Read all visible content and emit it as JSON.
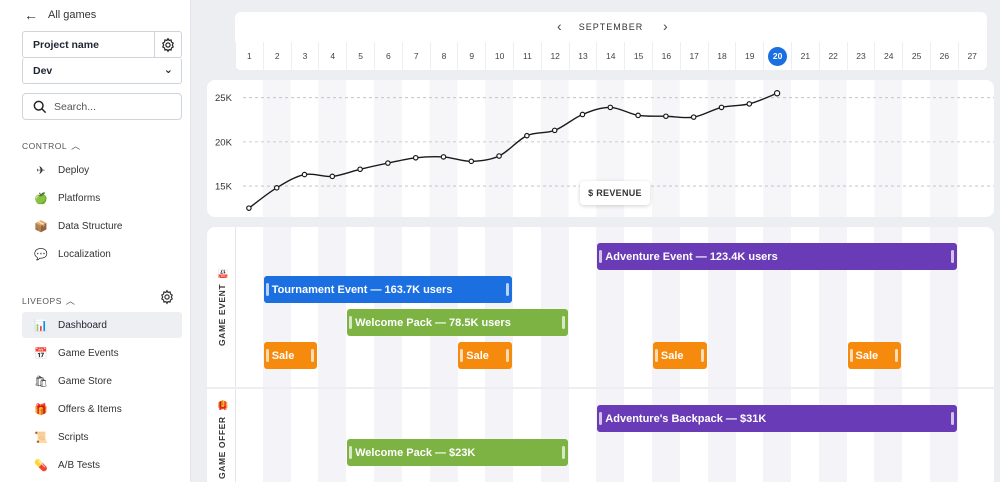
{
  "sidebar": {
    "back_label": "All games",
    "project_label": "Project name",
    "environment": "Dev",
    "search_placeholder": "Search...",
    "control_title": "CONTROL",
    "control_items": [
      {
        "label": "Deploy",
        "icon": "airplane-icon"
      },
      {
        "label": "Platforms",
        "icon": "apple-icon"
      },
      {
        "label": "Data Structure",
        "icon": "box-icon"
      },
      {
        "label": "Localization",
        "icon": "speech-bubble-icon"
      }
    ],
    "liveops_title": "LIVEOPS",
    "liveops_items": [
      {
        "label": "Dashboard",
        "icon": "bar-chart-icon",
        "active": true
      },
      {
        "label": "Game Events",
        "icon": "calendar-icon"
      },
      {
        "label": "Game Store",
        "icon": "shopping-bags-icon"
      },
      {
        "label": "Offers & Items",
        "icon": "gift-icon"
      },
      {
        "label": "Scripts",
        "icon": "scroll-icon"
      },
      {
        "label": "A/B Tests",
        "icon": "pill-icon"
      }
    ]
  },
  "calendar": {
    "month": "SEPTEMBER",
    "days": [
      "1",
      "2",
      "3",
      "4",
      "5",
      "6",
      "7",
      "8",
      "9",
      "10",
      "11",
      "12",
      "13",
      "14",
      "15",
      "16",
      "17",
      "18",
      "19",
      "20",
      "21",
      "22",
      "23",
      "24",
      "25",
      "26",
      "27"
    ],
    "today": "20"
  },
  "chart_data": {
    "type": "line",
    "title": "$ REVENUE",
    "x": [
      1,
      2,
      3,
      4,
      5,
      6,
      7,
      8,
      9,
      10,
      11,
      12,
      13,
      14,
      15,
      16,
      17,
      18,
      19,
      20
    ],
    "values": [
      12.5,
      14.8,
      16.3,
      16.1,
      16.9,
      17.6,
      18.2,
      18.3,
      17.8,
      18.4,
      20.7,
      21.3,
      23.1,
      23.9,
      23.0,
      22.9,
      22.8,
      23.9,
      24.3,
      25.5
    ],
    "yticks": [
      "25K",
      "20K",
      "15K"
    ],
    "ytick_values": [
      25,
      20,
      15
    ],
    "ylim": [
      11.5,
      27
    ],
    "grid": true,
    "color": "#1a1a1a"
  },
  "lanes": {
    "game_event": {
      "title": "GAME EVENT",
      "icon": "calendar-icon",
      "bars": [
        {
          "label": "Adventure Event — 123.4K users",
          "start": 14,
          "end": 26,
          "row": 0,
          "color": "#6a3bb6"
        },
        {
          "label": "Tournament Event — 163.7K users",
          "start": 2,
          "end": 10,
          "row": 1,
          "color": "#1b6fe0"
        },
        {
          "label": "Welcome Pack — 78.5K users",
          "start": 5,
          "end": 12,
          "row": 2,
          "color": "#7cb342"
        },
        {
          "label": "Sale",
          "start": 2,
          "end": 3,
          "row": 3,
          "color": "#f68a0c"
        },
        {
          "label": "Sale",
          "start": 9,
          "end": 10,
          "row": 3,
          "color": "#f68a0c"
        },
        {
          "label": "Sale",
          "start": 16,
          "end": 17,
          "row": 3,
          "color": "#f68a0c"
        },
        {
          "label": "Sale",
          "start": 23,
          "end": 24,
          "row": 3,
          "color": "#f68a0c"
        }
      ]
    },
    "game_offer": {
      "title": "GAME OFFER",
      "icon": "gift-icon",
      "bars": [
        {
          "label": "Adventure's Backpack — $31K",
          "start": 14,
          "end": 26,
          "row": 0,
          "color": "#6a3bb6"
        },
        {
          "label": "Welcome Pack — $23K",
          "start": 5,
          "end": 12,
          "row": 1,
          "color": "#7cb342"
        }
      ]
    }
  }
}
